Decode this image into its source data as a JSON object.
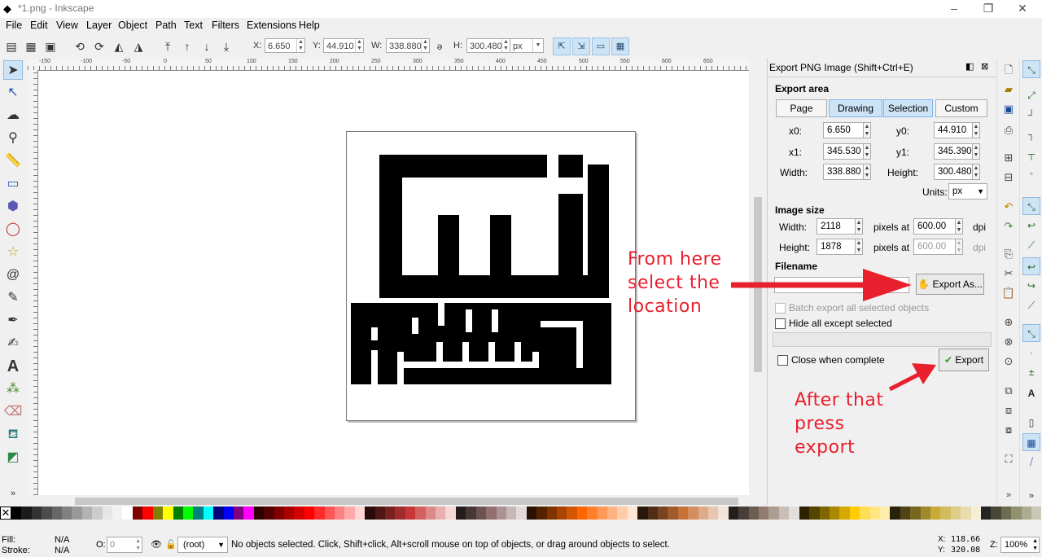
{
  "window": {
    "title": "*1.png - Inkscape"
  },
  "menu": [
    "File",
    "Edit",
    "View",
    "Layer",
    "Object",
    "Path",
    "Text",
    "Filters",
    "Extensions",
    "Help"
  ],
  "toolbar": {
    "x_label": "X:",
    "x_value": "6.650",
    "y_label": "Y:",
    "y_value": "44.910",
    "w_label": "W:",
    "w_value": "338.880",
    "h_label": "H:",
    "h_value": "300.480",
    "unit": "px"
  },
  "ruler_labels": [
    "-150",
    "-100",
    "-50",
    "0",
    "50",
    "100",
    "150",
    "200",
    "250",
    "300",
    "350",
    "400",
    "450",
    "500",
    "550",
    "600",
    "650"
  ],
  "export_panel": {
    "title": "Export PNG Image (Shift+Ctrl+E)",
    "export_area_label": "Export area",
    "tabs": [
      "Page",
      "Drawing",
      "Selection",
      "Custom"
    ],
    "x0_label": "x0:",
    "x0": "6.650",
    "y0_label": "y0:",
    "y0": "44.910",
    "x1_label": "x1:",
    "x1": "345.530",
    "y1_label": "y1:",
    "y1": "345.390",
    "width_label": "Width:",
    "width": "338.880",
    "height_label": "Height:",
    "height": "300.480",
    "units_label": "Units:",
    "units": "px",
    "image_size_label": "Image size",
    "img_width_label": "Width:",
    "img_width": "2118",
    "img_height_label": "Height:",
    "img_height": "1878",
    "pixels_at": "pixels at",
    "dpi_x": "600.00",
    "dpi_y": "600.00",
    "dpi": "dpi",
    "filename_label": "Filename",
    "filename": "",
    "export_as_label": "Export As...",
    "batch_label": "Batch export all selected objects",
    "hide_label": "Hide all except selected",
    "close_label": "Close when complete",
    "export_label": "Export"
  },
  "annotations": {
    "from_here": [
      "From here",
      "select the",
      "location"
    ],
    "after_that": [
      "After that",
      "press",
      "export"
    ]
  },
  "palette_colors": [
    "#000000",
    "#1a1a1a",
    "#333333",
    "#4d4d4d",
    "#666666",
    "#808080",
    "#999999",
    "#b3b3b3",
    "#cccccc",
    "#e6e6e6",
    "#f2f2f2",
    "#ffffff",
    "#800000",
    "#ff0000",
    "#808000",
    "#ffff00",
    "#008000",
    "#00ff00",
    "#008080",
    "#00ffff",
    "#000080",
    "#0000ff",
    "#800080",
    "#ff00ff",
    "#2b0000",
    "#550000",
    "#800000",
    "#aa0000",
    "#d40000",
    "#ff0000",
    "#ff2a2a",
    "#ff5555",
    "#ff8080",
    "#ffaaaa",
    "#ffd5d5",
    "#280b0b",
    "#501616",
    "#782121",
    "#a02c2c",
    "#c83737",
    "#d35f5f",
    "#de8787",
    "#e9afaf",
    "#f4d7d7",
    "#241c1c",
    "#483737",
    "#6c5353",
    "#916f6f",
    "#ac9393",
    "#c8b7b7",
    "#e3dbdb",
    "#2b1100",
    "#552200",
    "#803300",
    "#aa4400",
    "#d45500",
    "#ff6600",
    "#ff7f2a",
    "#ff9955",
    "#ffb380",
    "#ffccaa",
    "#ffe6d5",
    "#28170b",
    "#502d16",
    "#784421",
    "#a05a2c",
    "#c87137",
    "#d38d5f",
    "#deaa87",
    "#e9c6af",
    "#f4e3d7",
    "#241f1c",
    "#483e37",
    "#6c5d53",
    "#917c6f",
    "#ac9d93",
    "#c8beb7",
    "#e3dedb",
    "#2b2200",
    "#554400",
    "#806600",
    "#aa8800",
    "#d4aa00",
    "#ffcc00",
    "#ffdd55",
    "#ffe680",
    "#ffeeaa",
    "#28220b",
    "#504416",
    "#786721",
    "#a0892c",
    "#c8ab37",
    "#d3bc5f",
    "#decd87",
    "#e9ddaf",
    "#f4eed7",
    "#242424",
    "#484837",
    "#6c6c53",
    "#91916f",
    "#acac93",
    "#c8c8b7"
  ],
  "status": {
    "fill_label": "Fill:",
    "fill_value": "N/A",
    "stroke_label": "Stroke:",
    "stroke_value": "N/A",
    "opacity_label": "O:",
    "opacity_value": "0",
    "layer": "(root)",
    "message": "No objects selected. Click, Shift+click, Alt+scroll mouse on top of objects, or drag around objects to select.",
    "x_label": "X:",
    "x_value": "118.66",
    "y_label": "Y:",
    "y_value": "320.08",
    "zoom_label": "Z:",
    "zoom_value": "100%"
  }
}
